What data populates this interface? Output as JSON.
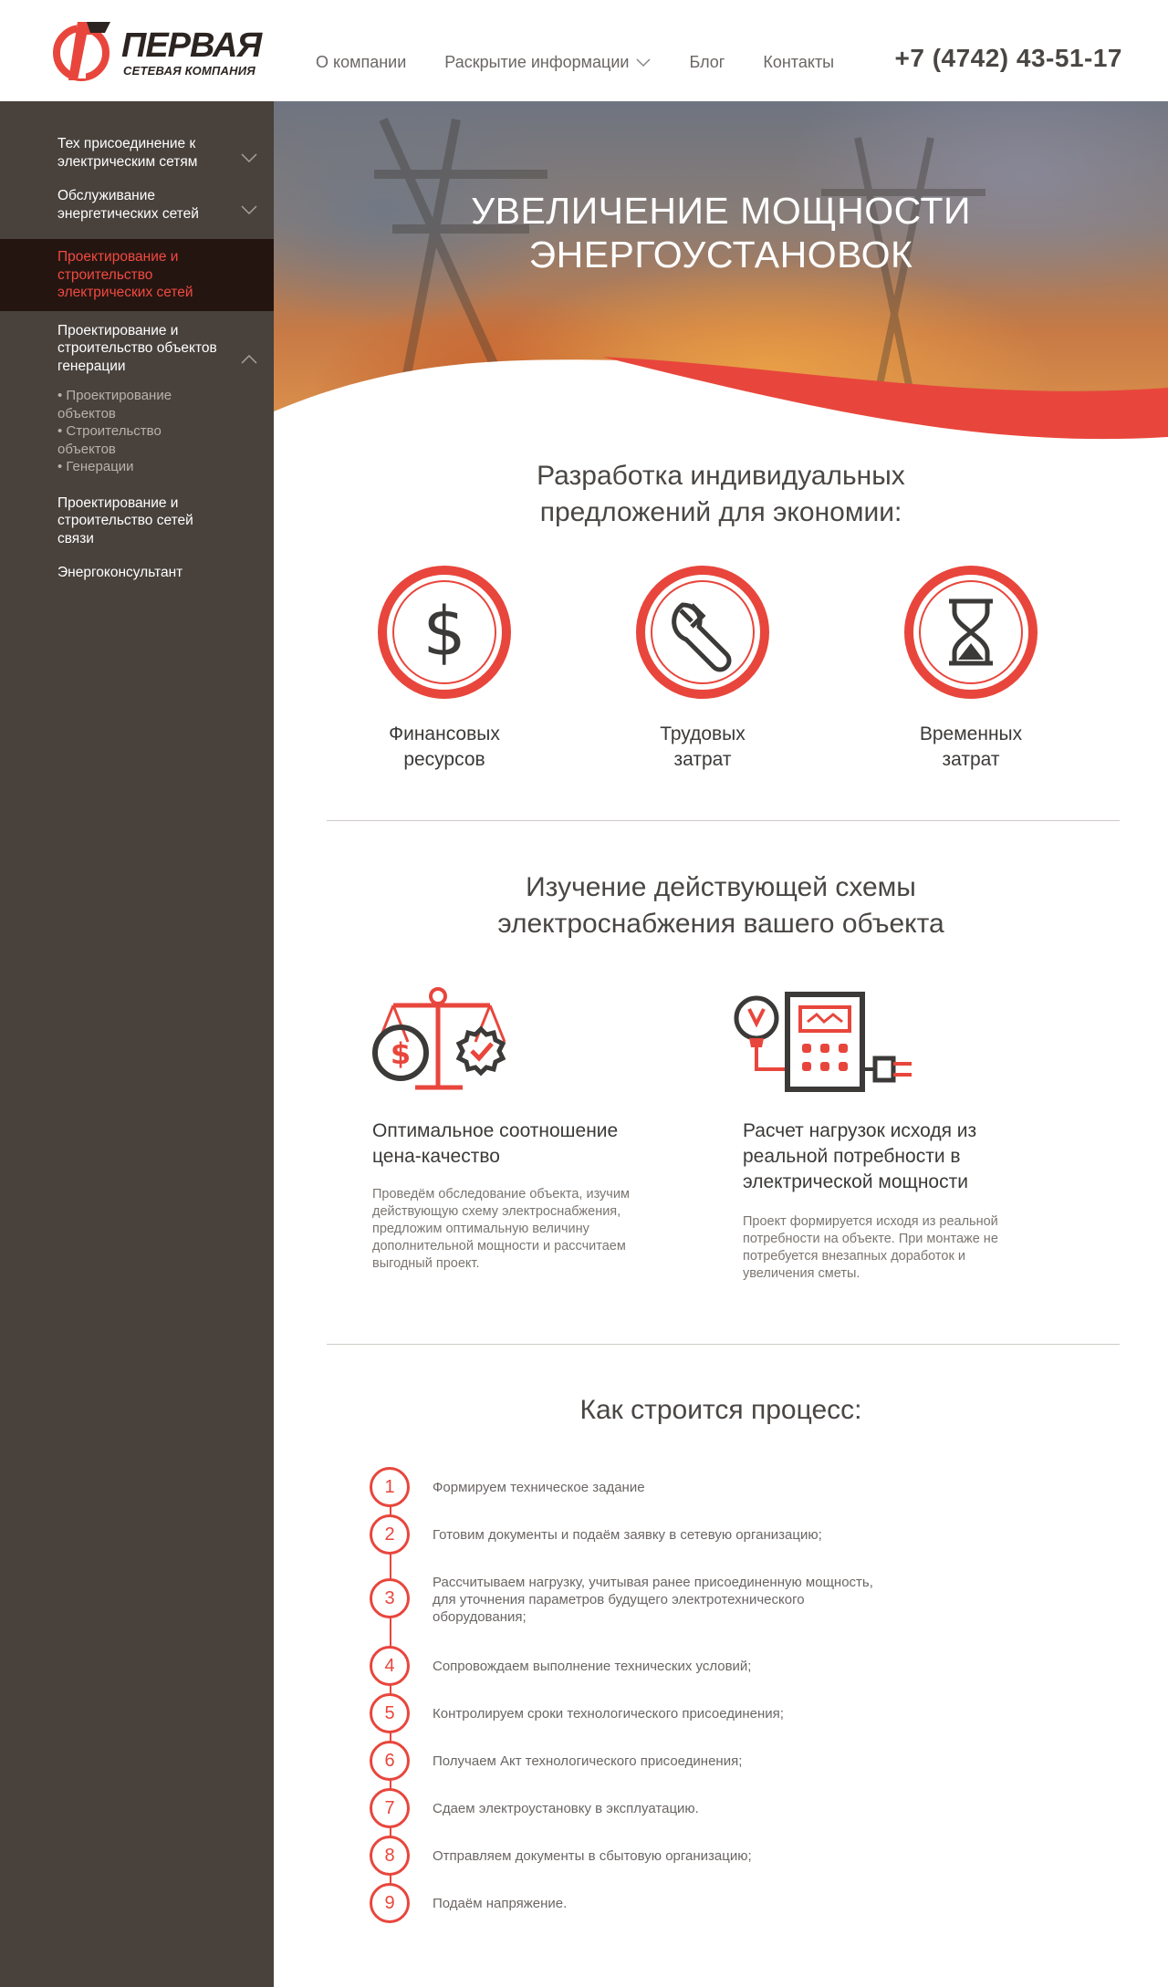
{
  "brand": {
    "name": "ПЕРВАЯ",
    "subtitle": "СЕТЕВАЯ КОМПАНИЯ",
    "accent": "#e8463c",
    "dark": "#48413c"
  },
  "nav": {
    "items": [
      "О компании",
      "Раскрытие информации",
      "Блог",
      "Контакты"
    ],
    "phone": "+7 (4742) 43-51-17"
  },
  "sidebar": {
    "items": [
      {
        "label": "Тех присоединение к электрическим сетям"
      },
      {
        "label": "Обслуживание энергетических сетей"
      },
      {
        "label": "Проектирование и строительство электрических сетей"
      },
      {
        "label": "Проектирование и строительство объектов генерации"
      },
      {
        "label": "Проектирование и строительство сетей связи"
      },
      {
        "label": "Энергоконсультант"
      }
    ],
    "subitems": [
      "• Проектирование объектов",
      "• Строительство объектов",
      "• Генерации"
    ]
  },
  "hero": {
    "line1": "УВЕЛИЧЕНИЕ МОЩНОСТИ",
    "line2": "ЭНЕРГОУСТАНОВОК"
  },
  "section1": {
    "title_line1": "Разработка индивидуальных",
    "title_line2": "предложений для экономии:",
    "items": [
      {
        "line1": "Финансовых",
        "line2": "ресурсов",
        "icon": "dollar-icon"
      },
      {
        "line1": "Трудовых",
        "line2": "затрат",
        "icon": "wrench-icon"
      },
      {
        "line1": "Временных",
        "line2": "затрат",
        "icon": "hourglass-icon"
      }
    ]
  },
  "section2": {
    "title_line1": "Изучение действующей схемы",
    "title_line2": "электроснабжения вашего объекта",
    "features": [
      {
        "title_line1": "Оптимальное соотношение",
        "title_line2": "цена-качество",
        "text": [
          "Проведём обследование объекта, изучим",
          "действующую схему электроснабжения,",
          "предложим оптимальную величину",
          "дополнительной мощности и рассчитаем",
          "выгодный проект."
        ],
        "icon": "scales-icon"
      },
      {
        "title_line1": "Расчет нагрузок исходя из",
        "title_line2": "реальной потребности в",
        "title_line3": "электрической мощности",
        "text": [
          "Проект формируется исходя из реальной",
          "потребности на объекте. При монтаже не",
          "потребуется внезапных доработок и",
          "увеличения сметы."
        ],
        "icon": "meter-icon"
      }
    ]
  },
  "process": {
    "title": "Как строится процесс:",
    "steps": [
      {
        "num": "1",
        "text": "Формируем техническое задание"
      },
      {
        "num": "2",
        "text": "Готовим документы и подаём заявку в сетевую организацию;"
      },
      {
        "num": "3",
        "lines": [
          "Рассчитываем нагрузку, учитывая ранее присоединенную мощность,",
          "для уточнения параметров будущего электротехнического",
          "оборудования;"
        ]
      },
      {
        "num": "4",
        "text": "Сопровождаем выполнение технических условий;"
      },
      {
        "num": "5",
        "text": "Контролируем сроки технологического присоединения;"
      },
      {
        "num": "6",
        "text": "Получаем Акт технологического присоединения;"
      },
      {
        "num": "7",
        "text": "Сдаем электроустановку в эксплуатацию."
      },
      {
        "num": "8",
        "text": "Отправляем документы в сбытовую организацию;"
      },
      {
        "num": "9",
        "text": "Подаём напряжение."
      }
    ]
  }
}
